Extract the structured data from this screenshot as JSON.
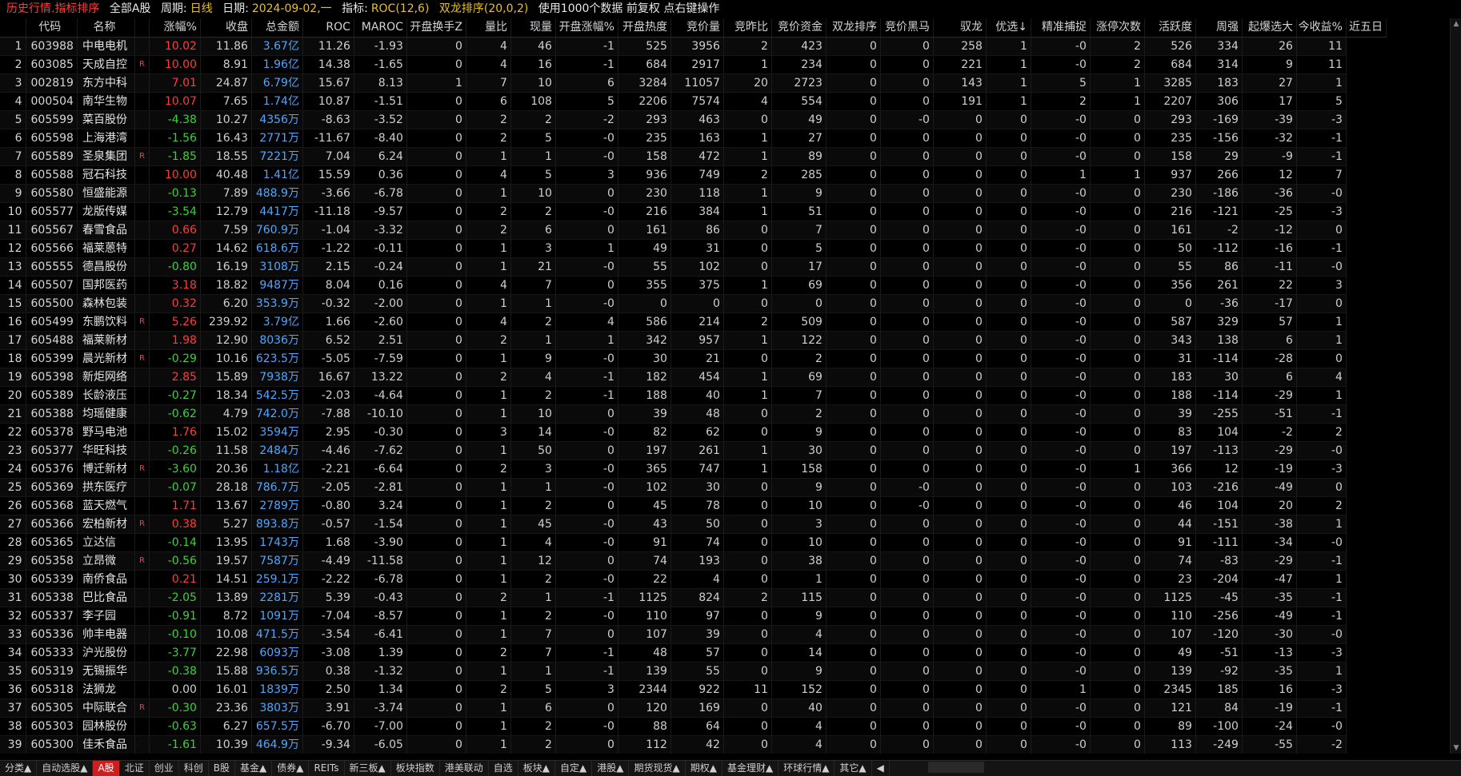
{
  "title": {
    "main": "历史行情.指标排序",
    "market": "全部A股",
    "period_label": "周期:",
    "period": "日线",
    "date_label": "日期:",
    "date": "2024-09-02,一",
    "indicator_label": "指标:",
    "indicator": "ROC(12,6)",
    "sort": "双龙排序(20,0,2)",
    "info": "使用1000个数据 前复权 点右键操作"
  },
  "columns": [
    "",
    "代码",
    "名称",
    "",
    "涨幅%",
    "收盘",
    "总金额",
    "ROC",
    "MAROC",
    "开盘换手Z",
    "量比",
    "现量",
    "开盘涨幅%",
    "开盘热度",
    "竞价量",
    "竞昨比",
    "竞价资金",
    "双龙排序",
    "竞价黑马",
    "驭龙",
    "优选↓",
    "精准捕捉",
    "涨停次数",
    "活跃度",
    "周强",
    "起爆选大",
    "今收益%",
    "近五日"
  ],
  "rows": [
    [
      "1",
      "603988",
      "中电电机",
      "",
      "10.02",
      "11.86",
      "3.67亿",
      "11.26",
      "-1.93",
      "0",
      "4",
      "46",
      "-1",
      "525",
      "3956",
      "2",
      "423",
      "0",
      "0",
      "258",
      "1",
      "-0",
      "2",
      "526",
      "334",
      "26",
      "11"
    ],
    [
      "2",
      "603085",
      "天成自控",
      "R",
      "10.00",
      "8.91",
      "1.96亿",
      "14.38",
      "-1.65",
      "0",
      "4",
      "16",
      "-1",
      "684",
      "2917",
      "1",
      "234",
      "0",
      "0",
      "221",
      "1",
      "-0",
      "2",
      "684",
      "314",
      "9",
      "11"
    ],
    [
      "3",
      "002819",
      "东方中科",
      "",
      "7.01",
      "24.87",
      "6.79亿",
      "15.67",
      "8.13",
      "1",
      "7",
      "10",
      "6",
      "3284",
      "11057",
      "20",
      "2723",
      "0",
      "0",
      "143",
      "1",
      "5",
      "1",
      "3285",
      "183",
      "27",
      "1"
    ],
    [
      "4",
      "000504",
      "南华生物",
      "",
      "10.07",
      "7.65",
      "1.74亿",
      "10.87",
      "-1.51",
      "0",
      "6",
      "108",
      "5",
      "2206",
      "7574",
      "4",
      "554",
      "0",
      "0",
      "191",
      "1",
      "2",
      "1",
      "2207",
      "306",
      "17",
      "5"
    ],
    [
      "5",
      "605599",
      "菜百股份",
      "",
      "-4.38",
      "10.27",
      "4356万",
      "-8.63",
      "-3.52",
      "0",
      "2",
      "2",
      "-2",
      "293",
      "463",
      "0",
      "49",
      "0",
      "-0",
      "0",
      "0",
      "-0",
      "0",
      "293",
      "-169",
      "-39",
      "-3"
    ],
    [
      "6",
      "605598",
      "上海港湾",
      "",
      "-1.56",
      "16.43",
      "2771万",
      "-11.67",
      "-8.40",
      "0",
      "2",
      "5",
      "-0",
      "235",
      "163",
      "1",
      "27",
      "0",
      "0",
      "0",
      "0",
      "-0",
      "0",
      "235",
      "-156",
      "-32",
      "-1"
    ],
    [
      "7",
      "605589",
      "圣泉集团",
      "R",
      "-1.85",
      "18.55",
      "7221万",
      "7.04",
      "6.24",
      "0",
      "1",
      "1",
      "-0",
      "158",
      "472",
      "1",
      "89",
      "0",
      "0",
      "0",
      "0",
      "-0",
      "0",
      "158",
      "29",
      "-9",
      "-1"
    ],
    [
      "8",
      "605588",
      "冠石科技",
      "",
      "10.00",
      "40.48",
      "1.41亿",
      "15.59",
      "0.36",
      "0",
      "4",
      "5",
      "3",
      "936",
      "749",
      "2",
      "285",
      "0",
      "0",
      "0",
      "0",
      "1",
      "1",
      "937",
      "266",
      "12",
      "7"
    ],
    [
      "9",
      "605580",
      "恒盛能源",
      "",
      "-0.13",
      "7.89",
      "488.9万",
      "-3.66",
      "-6.78",
      "0",
      "1",
      "10",
      "0",
      "230",
      "118",
      "1",
      "9",
      "0",
      "0",
      "0",
      "0",
      "-0",
      "0",
      "230",
      "-186",
      "-36",
      "-0"
    ],
    [
      "10",
      "605577",
      "龙版传媒",
      "",
      "-3.54",
      "12.79",
      "4417万",
      "-11.18",
      "-9.57",
      "0",
      "2",
      "2",
      "-0",
      "216",
      "384",
      "1",
      "51",
      "0",
      "0",
      "0",
      "0",
      "-0",
      "0",
      "216",
      "-121",
      "-25",
      "-3"
    ],
    [
      "11",
      "605567",
      "春雪食品",
      "",
      "0.66",
      "7.59",
      "760.9万",
      "-1.04",
      "-3.32",
      "0",
      "2",
      "6",
      "0",
      "161",
      "86",
      "0",
      "7",
      "0",
      "0",
      "0",
      "0",
      "-0",
      "0",
      "161",
      "-2",
      "-12",
      "0"
    ],
    [
      "12",
      "605566",
      "福莱蒽特",
      "",
      "0.27",
      "14.62",
      "618.6万",
      "-1.22",
      "-0.11",
      "0",
      "1",
      "3",
      "1",
      "49",
      "31",
      "0",
      "5",
      "0",
      "0",
      "0",
      "0",
      "-0",
      "0",
      "50",
      "-112",
      "-16",
      "-1"
    ],
    [
      "13",
      "605555",
      "德昌股份",
      "",
      "-0.80",
      "16.19",
      "3108万",
      "2.15",
      "-0.24",
      "0",
      "1",
      "21",
      "-0",
      "55",
      "102",
      "0",
      "17",
      "0",
      "0",
      "0",
      "0",
      "-0",
      "0",
      "55",
      "86",
      "-11",
      "-0"
    ],
    [
      "14",
      "605507",
      "国邦医药",
      "",
      "3.18",
      "18.82",
      "9487万",
      "8.04",
      "0.16",
      "0",
      "4",
      "7",
      "0",
      "355",
      "375",
      "1",
      "69",
      "0",
      "0",
      "0",
      "0",
      "-0",
      "0",
      "356",
      "261",
      "22",
      "3"
    ],
    [
      "15",
      "605500",
      "森林包装",
      "",
      "0.32",
      "6.20",
      "353.9万",
      "-0.32",
      "-2.00",
      "0",
      "1",
      "1",
      "-0",
      "0",
      "0",
      "0",
      "0",
      "0",
      "0",
      "0",
      "0",
      "-0",
      "0",
      "0",
      "-36",
      "-17",
      "0"
    ],
    [
      "16",
      "605499",
      "东鹏饮料",
      "R",
      "5.26",
      "239.92",
      "3.79亿",
      "1.66",
      "-2.60",
      "0",
      "4",
      "2",
      "4",
      "586",
      "214",
      "2",
      "509",
      "0",
      "0",
      "0",
      "0",
      "-0",
      "0",
      "587",
      "329",
      "57",
      "1"
    ],
    [
      "17",
      "605488",
      "福莱新材",
      "",
      "1.98",
      "12.90",
      "8036万",
      "6.52",
      "2.51",
      "0",
      "2",
      "1",
      "1",
      "342",
      "957",
      "1",
      "122",
      "0",
      "0",
      "0",
      "0",
      "-0",
      "0",
      "343",
      "138",
      "6",
      "1"
    ],
    [
      "18",
      "605399",
      "晨光新材",
      "R",
      "-0.29",
      "10.16",
      "623.5万",
      "-5.05",
      "-7.59",
      "0",
      "1",
      "9",
      "-0",
      "30",
      "21",
      "0",
      "2",
      "0",
      "0",
      "0",
      "0",
      "-0",
      "0",
      "31",
      "-114",
      "-28",
      "0"
    ],
    [
      "19",
      "605398",
      "新炬网络",
      "",
      "2.85",
      "15.89",
      "7938万",
      "16.67",
      "13.22",
      "0",
      "2",
      "4",
      "-1",
      "182",
      "454",
      "1",
      "69",
      "0",
      "0",
      "0",
      "0",
      "-0",
      "0",
      "183",
      "30",
      "6",
      "4"
    ],
    [
      "20",
      "605389",
      "长龄液压",
      "",
      "-0.27",
      "18.34",
      "542.5万",
      "-2.03",
      "-4.64",
      "0",
      "1",
      "2",
      "-1",
      "188",
      "40",
      "1",
      "7",
      "0",
      "0",
      "0",
      "0",
      "-0",
      "0",
      "188",
      "-114",
      "-29",
      "1"
    ],
    [
      "21",
      "605388",
      "均瑶健康",
      "",
      "-0.62",
      "4.79",
      "742.0万",
      "-7.88",
      "-10.10",
      "0",
      "1",
      "10",
      "0",
      "39",
      "48",
      "0",
      "2",
      "0",
      "0",
      "0",
      "0",
      "-0",
      "0",
      "39",
      "-255",
      "-51",
      "-1"
    ],
    [
      "22",
      "605378",
      "野马电池",
      "",
      "1.76",
      "15.02",
      "3594万",
      "2.95",
      "-0.30",
      "0",
      "3",
      "14",
      "-0",
      "82",
      "62",
      "0",
      "9",
      "0",
      "0",
      "0",
      "0",
      "-0",
      "0",
      "83",
      "104",
      "-2",
      "2"
    ],
    [
      "23",
      "605377",
      "华旺科技",
      "",
      "-0.26",
      "11.58",
      "2484万",
      "-4.46",
      "-7.62",
      "0",
      "1",
      "50",
      "0",
      "197",
      "261",
      "1",
      "30",
      "0",
      "0",
      "0",
      "0",
      "-0",
      "0",
      "197",
      "-113",
      "-29",
      "-0"
    ],
    [
      "24",
      "605376",
      "博迁新材",
      "R",
      "-3.60",
      "20.36",
      "1.18亿",
      "-2.21",
      "-6.64",
      "0",
      "2",
      "3",
      "-0",
      "365",
      "747",
      "1",
      "158",
      "0",
      "0",
      "0",
      "0",
      "-0",
      "1",
      "366",
      "12",
      "-19",
      "-3"
    ],
    [
      "25",
      "605369",
      "拱东医疗",
      "",
      "-0.07",
      "28.18",
      "786.7万",
      "-2.05",
      "-2.81",
      "0",
      "1",
      "1",
      "-0",
      "102",
      "30",
      "0",
      "9",
      "0",
      "-0",
      "0",
      "0",
      "-0",
      "0",
      "103",
      "-216",
      "-49",
      "0"
    ],
    [
      "26",
      "605368",
      "蓝天燃气",
      "",
      "1.71",
      "13.67",
      "2789万",
      "-0.80",
      "3.24",
      "0",
      "1",
      "2",
      "0",
      "45",
      "78",
      "0",
      "10",
      "0",
      "-0",
      "0",
      "0",
      "-0",
      "0",
      "46",
      "104",
      "20",
      "2"
    ],
    [
      "27",
      "605366",
      "宏柏新材",
      "R",
      "0.38",
      "5.27",
      "893.8万",
      "-0.57",
      "-1.54",
      "0",
      "1",
      "45",
      "-0",
      "43",
      "50",
      "0",
      "3",
      "0",
      "0",
      "0",
      "0",
      "-0",
      "0",
      "44",
      "-151",
      "-38",
      "1"
    ],
    [
      "28",
      "605365",
      "立达信",
      "",
      "-0.14",
      "13.95",
      "1743万",
      "1.68",
      "-3.90",
      "0",
      "1",
      "4",
      "-0",
      "91",
      "74",
      "0",
      "10",
      "0",
      "0",
      "0",
      "0",
      "-0",
      "0",
      "91",
      "-111",
      "-34",
      "-0"
    ],
    [
      "29",
      "605358",
      "立昂微",
      "R",
      "-0.56",
      "19.57",
      "7587万",
      "-4.49",
      "-11.58",
      "0",
      "1",
      "12",
      "0",
      "74",
      "193",
      "0",
      "38",
      "0",
      "0",
      "0",
      "0",
      "-0",
      "0",
      "74",
      "-83",
      "-29",
      "-1"
    ],
    [
      "30",
      "605339",
      "南侨食品",
      "",
      "0.21",
      "14.51",
      "259.1万",
      "-2.22",
      "-6.78",
      "0",
      "1",
      "2",
      "-0",
      "22",
      "4",
      "0",
      "1",
      "0",
      "0",
      "0",
      "0",
      "-0",
      "0",
      "23",
      "-204",
      "-47",
      "1"
    ],
    [
      "31",
      "605338",
      "巴比食品",
      "",
      "-2.05",
      "13.89",
      "2281万",
      "5.39",
      "-0.43",
      "0",
      "2",
      "1",
      "-1",
      "1125",
      "824",
      "2",
      "115",
      "0",
      "0",
      "0",
      "0",
      "-0",
      "0",
      "1125",
      "-45",
      "-35",
      "-1"
    ],
    [
      "32",
      "605337",
      "李子园",
      "",
      "-0.91",
      "8.72",
      "1091万",
      "-7.04",
      "-8.57",
      "0",
      "1",
      "2",
      "-0",
      "110",
      "97",
      "0",
      "9",
      "0",
      "0",
      "0",
      "0",
      "-0",
      "0",
      "110",
      "-256",
      "-49",
      "-1"
    ],
    [
      "33",
      "605336",
      "帅丰电器",
      "",
      "-0.10",
      "10.08",
      "471.5万",
      "-3.54",
      "-6.41",
      "0",
      "1",
      "7",
      "0",
      "107",
      "39",
      "0",
      "4",
      "0",
      "0",
      "0",
      "0",
      "-0",
      "0",
      "107",
      "-120",
      "-30",
      "-0"
    ],
    [
      "34",
      "605333",
      "沪光股份",
      "",
      "-3.77",
      "22.98",
      "6093万",
      "-3.08",
      "1.39",
      "0",
      "2",
      "7",
      "-1",
      "48",
      "57",
      "0",
      "14",
      "0",
      "0",
      "0",
      "0",
      "-0",
      "0",
      "49",
      "-51",
      "-13",
      "-3"
    ],
    [
      "35",
      "605319",
      "无锡振华",
      "",
      "-0.38",
      "15.88",
      "936.5万",
      "0.38",
      "-1.32",
      "0",
      "1",
      "1",
      "-1",
      "139",
      "55",
      "0",
      "9",
      "0",
      "0",
      "0",
      "0",
      "-0",
      "0",
      "139",
      "-92",
      "-35",
      "1"
    ],
    [
      "36",
      "605318",
      "法狮龙",
      "",
      "0.00",
      "16.01",
      "1839万",
      "2.50",
      "1.34",
      "0",
      "2",
      "5",
      "3",
      "2344",
      "922",
      "11",
      "152",
      "0",
      "0",
      "0",
      "0",
      "1",
      "0",
      "2345",
      "185",
      "16",
      "-3"
    ],
    [
      "37",
      "605305",
      "中际联合",
      "R",
      "-0.30",
      "23.36",
      "3803万",
      "3.91",
      "-3.74",
      "0",
      "1",
      "6",
      "0",
      "120",
      "169",
      "0",
      "40",
      "0",
      "0",
      "0",
      "0",
      "-0",
      "0",
      "121",
      "84",
      "-19",
      "-1"
    ],
    [
      "38",
      "605303",
      "园林股份",
      "",
      "-0.63",
      "6.27",
      "657.5万",
      "-6.70",
      "-7.00",
      "0",
      "1",
      "2",
      "-0",
      "88",
      "64",
      "0",
      "4",
      "0",
      "0",
      "0",
      "0",
      "-0",
      "0",
      "89",
      "-100",
      "-24",
      "-0"
    ],
    [
      "39",
      "605300",
      "佳禾食品",
      "",
      "-1.61",
      "10.39",
      "464.9万",
      "-9.34",
      "-6.05",
      "0",
      "1",
      "2",
      "0",
      "112",
      "42",
      "0",
      "4",
      "0",
      "0",
      "0",
      "0",
      "-0",
      "0",
      "113",
      "-249",
      "-55",
      "-2"
    ]
  ],
  "tabs": [
    "分类▲",
    "自动选股▲",
    "A股",
    "北证",
    "创业",
    "科创",
    "B股",
    "基金▲",
    "债券▲",
    "REITs",
    "新三板▲",
    "板块指数",
    "港美联动",
    "自选",
    "板块▲",
    "自定▲",
    "港股▲",
    "期货现货▲",
    "期权▲",
    "基金理财▲",
    "环球行情▲",
    "其它▲"
  ],
  "active_tab_index": 2,
  "colors": {
    "up": "#ff3b3b",
    "down": "#3ad13a",
    "amount": "#4fa6ff",
    "background": "#000000",
    "active_tab": "#cc1f1f"
  }
}
